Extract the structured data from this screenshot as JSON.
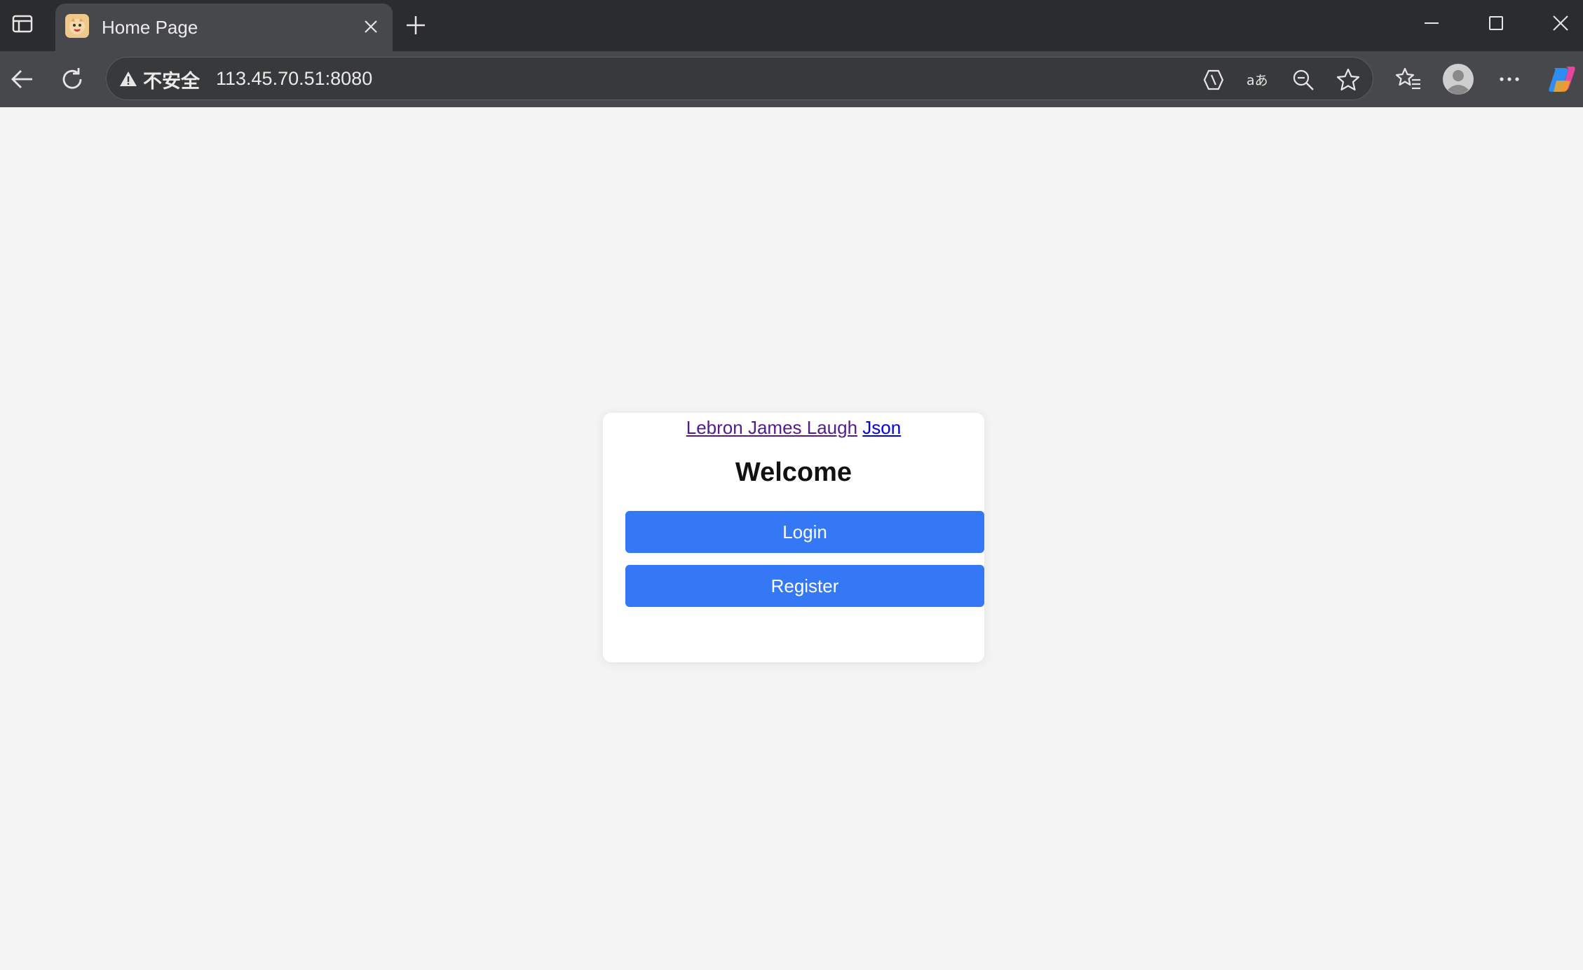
{
  "browser": {
    "tab": {
      "title": "Home Page",
      "favicon": "cat-favicon-icon"
    },
    "address": {
      "security_label": "不安全",
      "url": "113.45.70.51:8080"
    },
    "icons": {
      "sidebar": "tab-sidebar-icon",
      "close_tab": "close-icon",
      "new_tab": "plus-icon",
      "minimize": "minimize-icon",
      "maximize": "maximize-icon",
      "close_window": "close-icon",
      "back": "back-arrow-icon",
      "refresh": "refresh-icon",
      "warning": "warning-icon",
      "copilot_page": "copilot-page-icon",
      "translate": "translate-icon",
      "zoom_out": "zoom-out-icon",
      "favorite": "star-icon",
      "favorites": "favorites-list-icon",
      "profile": "profile-avatar-icon",
      "more": "more-dots-icon",
      "copilot": "copilot-icon"
    }
  },
  "page": {
    "title": "Welcome",
    "login_label": "Login",
    "register_label": "Register",
    "links": [
      "Lebron James Laugh",
      "Json"
    ],
    "accent_color": "#3478f6"
  }
}
